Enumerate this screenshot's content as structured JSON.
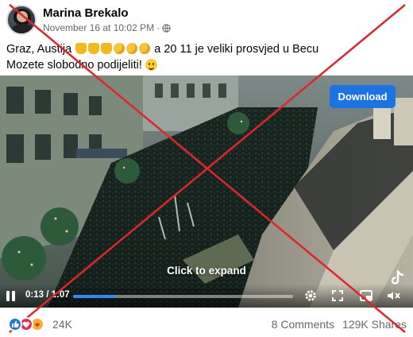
{
  "post": {
    "author": "Marina Brekalo",
    "timestamp": "November 16 at 10:02 PM",
    "separator": "·",
    "audience_icon": "globe-icon",
    "more_icon": "ellipsis-icon",
    "more_label": "···",
    "caption_line1_prefix": "Graz, Austija",
    "caption_line1_suffix": "a 20 11 je veliki prosvjed u Becu",
    "caption_line2": "Mozete slobodno podijeliti!",
    "caption_emojis": [
      "thumbs-up-emoji",
      "thumbs-up-emoji",
      "thumbs-up-emoji",
      "clapping-hands-emoji",
      "clapping-hands-emoji",
      "clapping-hands-emoji"
    ],
    "caption_end_emoji": "smiling-face-emoji"
  },
  "video": {
    "download_label": "Download",
    "expand_label": "Click to expand",
    "time_current": "0:13",
    "time_separator": " / ",
    "time_total": "1:07",
    "progress_fraction": 0.19,
    "watermark_icon": "tiktok-icon"
  },
  "footer": {
    "reaction_icons": [
      "like-reaction-icon",
      "love-reaction-icon",
      "care-reaction-icon"
    ],
    "reaction_count": "24K",
    "comments": "8 Comments",
    "shares": "129K Shares"
  },
  "colors": {
    "accent": "#1b74e4",
    "progress": "#2d88ff",
    "overlay_x": "#e3242b",
    "muted_text": "#65676b"
  }
}
